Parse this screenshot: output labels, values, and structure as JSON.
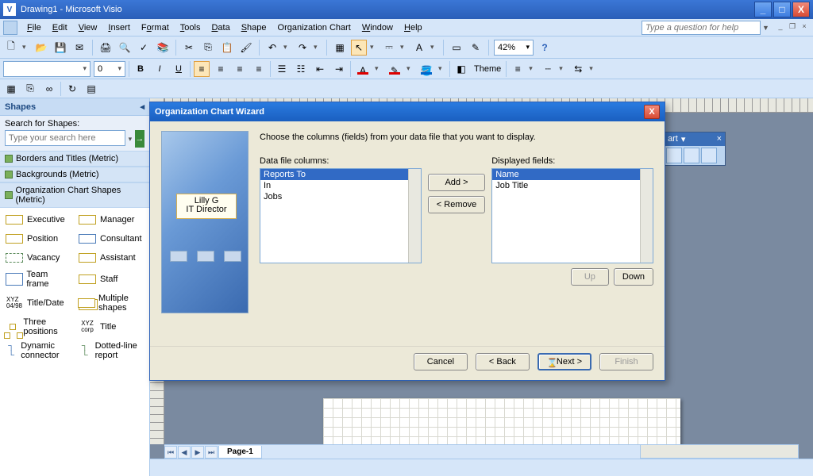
{
  "titlebar": {
    "title": "Drawing1 - Microsoft Visio"
  },
  "menubar": {
    "file": "File",
    "edit": "Edit",
    "view": "View",
    "insert": "Insert",
    "format": "Format",
    "tools": "Tools",
    "data": "Data",
    "shape": "Shape",
    "orgchart": "Organization Chart",
    "window": "Window",
    "help": "Help",
    "help_placeholder": "Type a question for help"
  },
  "toolbar": {
    "zoom": "42%"
  },
  "formatbar": {
    "font": "",
    "size": "0",
    "theme_label": "Theme"
  },
  "shapes": {
    "header": "Shapes",
    "search_label": "Search for Shapes:",
    "search_placeholder": "Type your search here",
    "stencils": [
      "Borders and Titles (Metric)",
      "Backgrounds (Metric)",
      "Organization Chart Shapes (Metric)"
    ],
    "items": [
      "Executive",
      "Manager",
      "Position",
      "Consultant",
      "Vacancy",
      "Assistant",
      "Team frame",
      "Staff",
      "Title/Date",
      "Multiple shapes",
      "Three positions",
      "Title",
      "Dynamic connector",
      "Dotted-line report"
    ]
  },
  "float_toolbar": {
    "title": "art"
  },
  "page_tabs": {
    "page1": "Page-1"
  },
  "dialog": {
    "title": "Organization Chart Wizard",
    "instruction": "Choose the columns (fields) from your data file that you want to display.",
    "left_label": "Data file columns:",
    "right_label": "Displayed fields:",
    "left_items": [
      "Reports To",
      "In",
      "Jobs"
    ],
    "right_items": [
      "Name",
      "Job Title"
    ],
    "graphic_name": "Lilly G",
    "graphic_role": "IT Director",
    "add": "Add >",
    "remove": "< Remove",
    "up": "Up",
    "down": "Down",
    "cancel": "Cancel",
    "back": "< Back",
    "next": "Next >",
    "finish": "Finish"
  }
}
